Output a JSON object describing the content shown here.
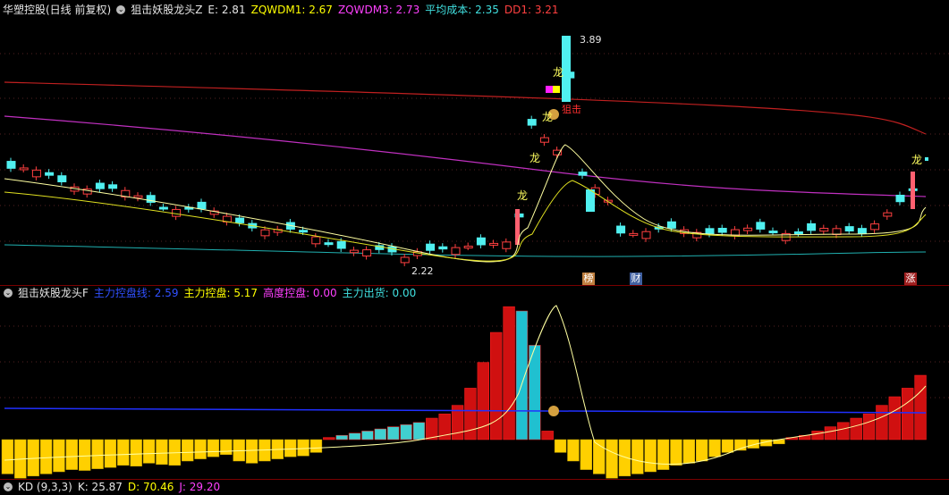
{
  "top": {
    "title": "华塑控股(日线 前复权)",
    "indicator": "狙击妖股龙头Z",
    "fields": [
      {
        "label": "E: 2.81",
        "color": "#e6e6e6"
      },
      {
        "label": "ZQWDM1: 2.67",
        "color": "#ffff00"
      },
      {
        "label": "ZQWDM3: 2.73",
        "color": "#ff40ff"
      },
      {
        "label": "平均成本: 2.35",
        "color": "#40e0e0"
      },
      {
        "label": "DD1: 3.21",
        "color": "#ff4040"
      }
    ],
    "annotations": {
      "high_price": "3.89",
      "low_price": "2.22",
      "dragon_labels": [
        "龙",
        "龙",
        "龙",
        "龙",
        "龙"
      ],
      "snipe_label": "狙击",
      "tags": [
        {
          "text": "榜",
          "color": "#c08040"
        },
        {
          "text": "财",
          "color": "#4060a0"
        },
        {
          "text": "涨",
          "color": "#a02020"
        }
      ]
    }
  },
  "middle": {
    "indicator": "狙击妖股龙头F",
    "fields": [
      {
        "label": "主力控盘线: 2.59",
        "color": "#3050ff"
      },
      {
        "label": "主力控盘: 5.17",
        "color": "#ffff00"
      },
      {
        "label": "高度控盘: 0.00",
        "color": "#ff40ff"
      },
      {
        "label": "主力出货: 0.00",
        "color": "#40e0e0"
      }
    ]
  },
  "bottom": {
    "indicator": "KD (9,3,3)",
    "fields": [
      {
        "label": "K: 25.87",
        "color": "#e6e6e6"
      },
      {
        "label": "D: 70.46",
        "color": "#ffff00"
      },
      {
        "label": "J: 29.20",
        "color": "#ff40ff"
      }
    ]
  },
  "chart_data": {
    "type": "candlestick",
    "y_high": 3.89,
    "y_low": 2.22,
    "macd_bars": [
      -0.8,
      -0.9,
      -0.85,
      -0.8,
      -0.75,
      -0.7,
      -0.72,
      -0.68,
      -0.65,
      -0.6,
      -0.62,
      -0.55,
      -0.58,
      -0.6,
      -0.5,
      -0.45,
      -0.4,
      -0.35,
      -0.5,
      -0.55,
      -0.5,
      -0.45,
      -0.4,
      -0.38,
      -0.3,
      0.05,
      0.1,
      0.15,
      0.2,
      0.25,
      0.3,
      0.35,
      0.4,
      0.5,
      0.6,
      0.8,
      1.2,
      1.8,
      2.5,
      3.1,
      3.0,
      2.2,
      0.2,
      -0.3,
      -0.5,
      -0.7,
      -0.8,
      -0.9,
      -0.85,
      -0.8,
      -0.75,
      -0.7,
      -0.6,
      -0.55,
      -0.5,
      -0.4,
      -0.3,
      -0.25,
      -0.2,
      -0.15,
      -0.1,
      0.05,
      0.1,
      0.2,
      0.3,
      0.4,
      0.5,
      0.6,
      0.8,
      1.0,
      1.2,
      1.5
    ]
  }
}
